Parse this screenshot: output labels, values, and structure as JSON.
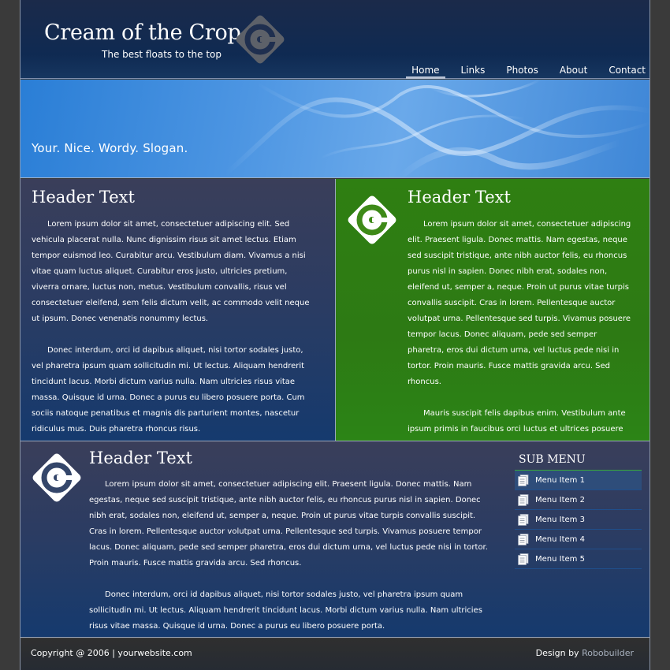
{
  "site": {
    "title": "Cream of the Crop",
    "tagline": "The best floats to the top"
  },
  "nav": {
    "items": [
      {
        "label": "Home",
        "active": true
      },
      {
        "label": "Links"
      },
      {
        "label": "Photos"
      },
      {
        "label": "About"
      },
      {
        "label": "Contact"
      }
    ]
  },
  "banner": {
    "slogan": "Your. Nice. Wordy. Slogan."
  },
  "left_panel": {
    "header": "Header Text",
    "paragraphs": [
      "Lorem ipsum dolor sit amet, consectetuer adipiscing elit. Sed vehicula placerat nulla. Nunc dignissim risus sit amet lectus. Etiam tempor euismod leo. Curabitur arcu. Vestibulum diam. Vivamus a nisi vitae quam luctus aliquet. Curabitur eros justo, ultricies pretium, viverra ornare, luctus non, metus. Vestibulum convallis, risus vel consectetuer eleifend, sem felis dictum velit, ac commodo velit neque ut ipsum. Donec venenatis nonummy lectus.",
      "Donec interdum, orci id dapibus aliquet, nisi tortor sodales justo, vel pharetra ipsum quam sollicitudin mi. Ut lectus. Aliquam hendrerit tincidunt lacus. Morbi dictum varius nulla. Nam ultricies risus vitae massa. Quisque id urna. Donec a purus eu libero posuere porta. Cum sociis natoque penatibus et magnis dis parturient montes, nascetur ridiculus mus. Duis pharetra rhoncus risus."
    ]
  },
  "right_panel": {
    "header": "Header Text",
    "paragraphs": [
      "Lorem ipsum dolor sit amet, consectetuer adipiscing elit. Praesent ligula. Donec mattis. Nam egestas, neque sed suscipit tristique, ante nibh auctor felis, eu rhoncus purus nisl in sapien. Donec nibh erat, sodales non, eleifend ut, semper a, neque. Proin ut purus vitae turpis convallis suscipit. Cras in lorem. Pellentesque auctor volutpat urna. Pellentesque sed turpis. Vivamus posuere tempor lacus. Donec aliquam, pede sed semper pharetra, eros dui dictum urna, vel luctus pede nisi in tortor. Proin mauris. Fusce mattis gravida arcu. Sed rhoncus.",
      "Mauris suscipit felis dapibus enim. Vestibulum ante ipsum primis in faucibus orci luctus et ultrices posuere cubilia Curae; Cum sociis natoque penatibus et magnis."
    ]
  },
  "bottom_panel": {
    "header": "Header Text",
    "paragraphs": [
      "Lorem ipsum dolor sit amet, consectetuer adipiscing elit. Praesent ligula. Donec mattis. Nam egestas, neque sed suscipit tristique, ante nibh auctor felis, eu rhoncus purus nisl in sapien. Donec nibh erat, sodales non, eleifend ut, semper a, neque. Proin ut purus vitae turpis convallis suscipit. Cras in lorem. Pellentesque auctor volutpat urna. Pellentesque sed turpis. Vivamus posuere tempor lacus. Donec aliquam, pede sed semper pharetra, eros dui dictum urna, vel luctus pede nisi in tortor. Proin mauris. Fusce mattis gravida arcu. Sed rhoncus.",
      "Donec interdum, orci id dapibus aliquet, nisi tortor sodales justo, vel pharetra ipsum quam sollicitudin mi. Ut lectus. Aliquam hendrerit tincidunt lacus. Morbi dictum varius nulla. Nam ultricies risus vitae massa. Quisque id urna. Donec a purus eu libero posuere porta."
    ]
  },
  "submenu": {
    "title": "SUB MENU",
    "items": [
      {
        "label": "Menu Item 1",
        "active": true
      },
      {
        "label": "Menu Item 2"
      },
      {
        "label": "Menu Item 3"
      },
      {
        "label": "Menu Item 4"
      },
      {
        "label": "Menu Item 5"
      }
    ]
  },
  "footer": {
    "copyright": "Copyright @ 2006 | yourwebsite.com",
    "credit_prefix": "Design by ",
    "credit_link": "Robobuilder"
  },
  "colors": {
    "header_bg": "#0f2a52",
    "banner_blue": "#4c95e2",
    "panel_green": "#2d7a14",
    "panel_blue": "#153a6e",
    "submenu_divider": "#39a93a",
    "logo_gray": "#6e7177"
  },
  "icons": {
    "logo": "diamond-c-logo-icon",
    "submenu_item": "document-icon"
  }
}
